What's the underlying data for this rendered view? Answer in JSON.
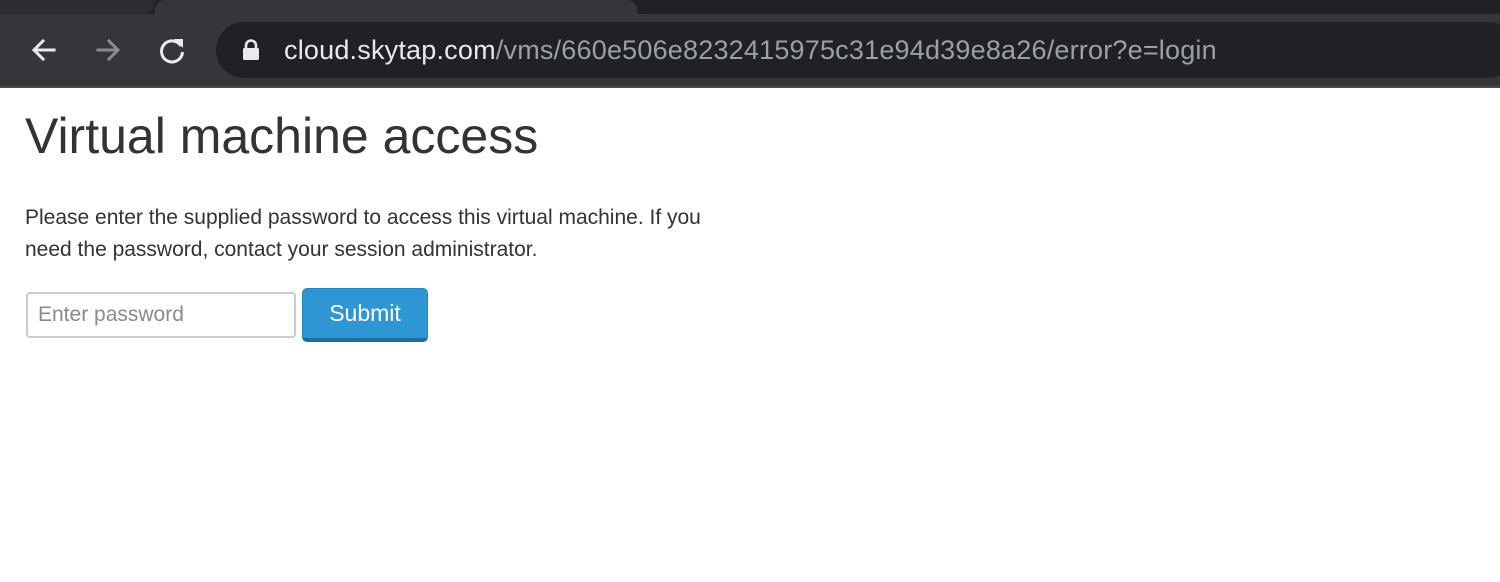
{
  "browser": {
    "url_host": "cloud.skytap.com",
    "url_path": "/vms/660e506e8232415975c31e94d39e8a26/error?e=login",
    "icons": {
      "back": "arrow-left-icon",
      "forward": "arrow-right-icon",
      "reload": "reload-icon",
      "lock": "lock-icon"
    }
  },
  "page": {
    "title": "Virtual machine access",
    "description": "Please enter the supplied password to access this virtual machine. If you need the password, contact your session administrator.",
    "password_placeholder": "Enter password",
    "password_value": "",
    "submit_label": "Submit"
  },
  "colors": {
    "chrome_bg": "#35363a",
    "omnibox_bg": "#202124",
    "button_bg": "#2e96d3",
    "text": "#333333"
  }
}
